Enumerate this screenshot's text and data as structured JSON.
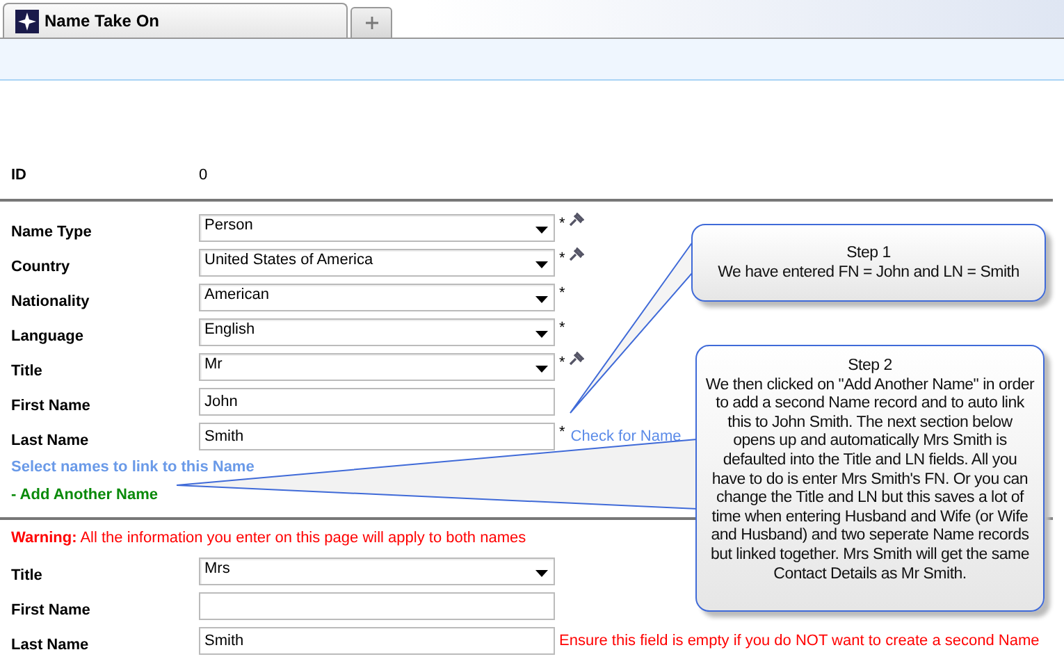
{
  "tabs": [
    {
      "label": "Name Take On",
      "selected": true
    }
  ],
  "id_row": {
    "label": "ID",
    "value": "0"
  },
  "fields": [
    {
      "kind": "select",
      "label": "Name Type",
      "value": "Person",
      "marker": "*",
      "pinned": true
    },
    {
      "kind": "select",
      "label": "Country",
      "value": "United States of America",
      "marker": "*",
      "pinned": true
    },
    {
      "kind": "select",
      "label": "Nationality",
      "value": "American",
      "marker": "*",
      "pinned": false
    },
    {
      "kind": "select",
      "label": "Language",
      "value": "English",
      "marker": "*",
      "pinned": false
    },
    {
      "kind": "select",
      "label": "Title",
      "value": "Mr",
      "marker": "*",
      "pinned": true
    },
    {
      "kind": "text",
      "label": "First Name",
      "value": "John"
    },
    {
      "kind": "text",
      "label": "Last Name",
      "value": "Smith",
      "marker": "*",
      "link": "Check for Name"
    }
  ],
  "link_names": "Select names to link to this Name",
  "add_another": "- Add Another Name",
  "warning": "**Warning:** All the information you enter on this page will apply to both names",
  "second_fields": [
    {
      "kind": "select",
      "label": "Title",
      "value": "Mrs"
    },
    {
      "kind": "text",
      "label": "First Name"
    },
    {
      "kind": "text",
      "label": "Last Name",
      "value": "Smith",
      "note": "Ensure this field is empty if you do NOT want to create a second Name"
    }
  ],
  "callouts": [
    {
      "title": "Step 1",
      "body": "We have entered FN = John and LN = Smith"
    },
    {
      "title": "Step 2",
      "body": "We then clicked on \"Add Another Name\" in order to add a second Name record and to auto link this to John Smith. The next section below opens up and automatically Mrs Smith is defaulted into the Title and LN fields.  All you have to do is enter Mrs Smith's FN.  Or you can change the Title and LN but this saves a lot of time when entering Husband and Wife (or Wife and Husband) and two seperate Name records but linked together. Mrs Smith will get the same Contact Details as Mr Smith."
    }
  ]
}
